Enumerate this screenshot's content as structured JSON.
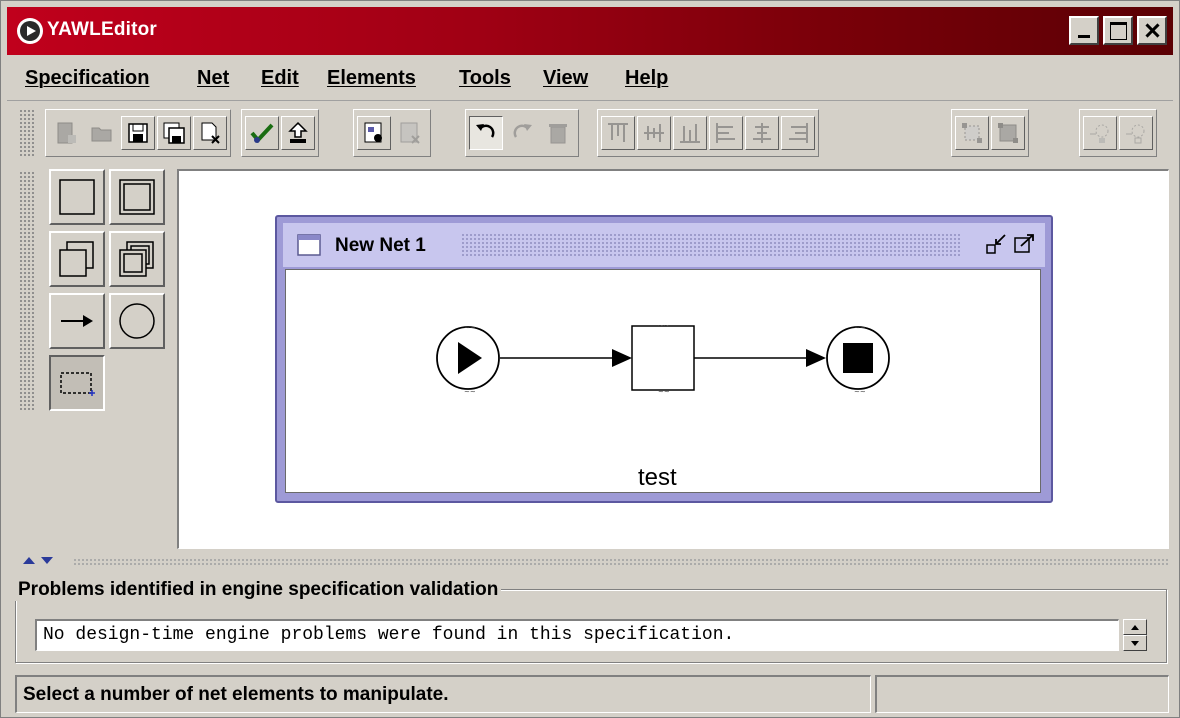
{
  "window": {
    "title": "YAWLEditor",
    "controls": [
      "minimize",
      "maximize",
      "close"
    ]
  },
  "menu": {
    "items": [
      {
        "label": "Specification"
      },
      {
        "label": "Net"
      },
      {
        "label": "Edit"
      },
      {
        "label": "Elements"
      },
      {
        "label": "Tools"
      },
      {
        "label": "View"
      },
      {
        "label": "Help"
      }
    ]
  },
  "toolbar": {
    "groups": [
      [
        "new-specification-icon",
        "open-specification-icon",
        "save-specification-icon",
        "save-as-icon",
        "close-specification-icon"
      ],
      [
        "validate-specification-icon",
        "export-engine-icon"
      ],
      [
        "create-net-icon",
        "remove-net-icon"
      ],
      [
        "undo-icon",
        "redo-icon",
        "delete-icon"
      ],
      [
        "align-top-icon",
        "align-vertical-center-icon",
        "align-bottom-icon",
        "align-left-icon",
        "align-horizontal-center-icon",
        "align-right-icon"
      ],
      [
        "increase-size-icon",
        "decrease-size-icon"
      ],
      [
        "add-cancellation-icon",
        "remove-cancellation-icon"
      ]
    ]
  },
  "palette": {
    "tools": [
      "atomic-task",
      "multiple-atomic-task",
      "composite-task",
      "multiple-composite-task",
      "flow-relation",
      "condition",
      "marquee-select"
    ],
    "selected": "marquee-select"
  },
  "net": {
    "title": "New Net 1",
    "task_label": "test",
    "elements": [
      "input-condition",
      "task",
      "output-condition"
    ]
  },
  "problems": {
    "title": "Problems identified in engine specification validation",
    "message": "No design-time engine problems were found in this specification."
  },
  "status": {
    "message": "Select a number of net elements to manipulate.",
    "secondary": ""
  },
  "colors": {
    "titlebar": "#b00018",
    "window_bg": "#d4d0c8",
    "net_frame": "#9e9ad6",
    "net_title": "#c8c6ee"
  }
}
